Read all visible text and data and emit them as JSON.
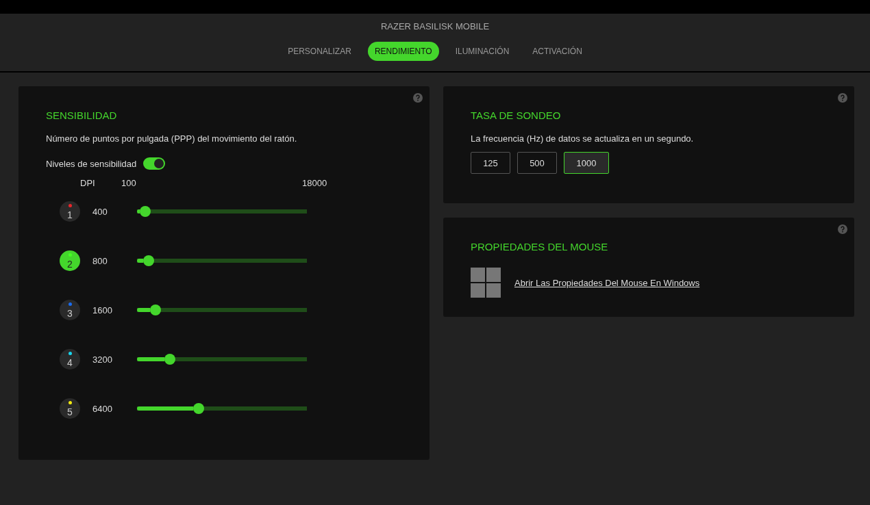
{
  "window": {
    "title": "RAZER BASILISK MOBILE"
  },
  "tabs": [
    {
      "label": "PERSONALIZAR",
      "selected": false
    },
    {
      "label": "RENDIMIENTO",
      "selected": true
    },
    {
      "label": "ILUMINACIÓN",
      "selected": false
    },
    {
      "label": "ACTIVACIÓN",
      "selected": false
    }
  ],
  "sensitivity": {
    "title": "SENSIBILIDAD",
    "description": "Número de puntos por pulgada (PPP) del movimiento del ratón.",
    "stages_label": "Niveles de sensibilidad",
    "stages_on": true,
    "dpi_label": "DPI",
    "min": "100",
    "max": "18000",
    "stages": [
      {
        "number": "1",
        "color": "#e8262b",
        "selected": false,
        "value": "400",
        "level": 0.017
      },
      {
        "number": "2",
        "color": "#44ff22",
        "selected": true,
        "value": "800",
        "level": 0.039
      },
      {
        "number": "3",
        "color": "#1a6cf0",
        "selected": false,
        "value": "1600",
        "level": 0.084
      },
      {
        "number": "4",
        "color": "#18d6ee",
        "selected": false,
        "value": "3200",
        "level": 0.173
      },
      {
        "number": "5",
        "color": "#f2ea10",
        "selected": false,
        "value": "6400",
        "level": 0.352
      }
    ]
  },
  "polling": {
    "title": "TASA DE SONDEO",
    "description": "La frecuencia (Hz) de datos se actualiza en un segundo.",
    "options": [
      {
        "label": "125",
        "selected": false
      },
      {
        "label": "500",
        "selected": false
      },
      {
        "label": "1000",
        "selected": true
      }
    ]
  },
  "mouse_properties": {
    "title": "PROPIEDADES DEL MOUSE",
    "link": "Abrir Las Propiedades Del Mouse En Windows"
  }
}
